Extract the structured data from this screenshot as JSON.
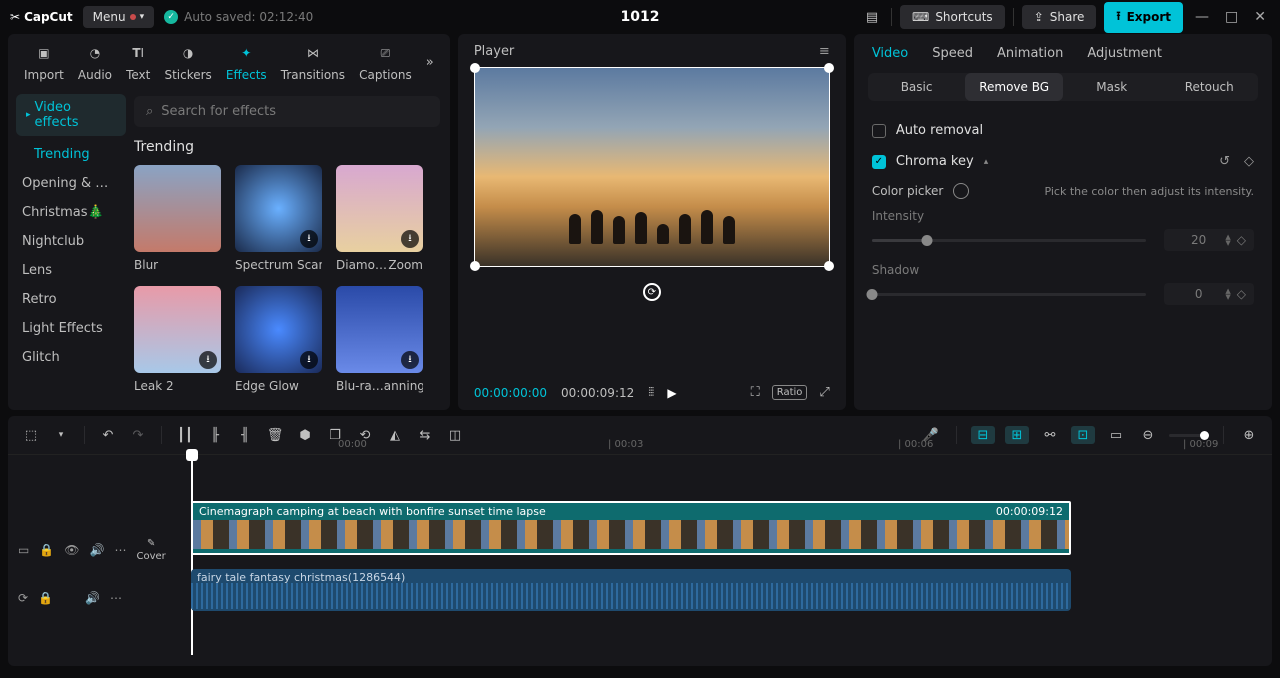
{
  "brand": "CapCut",
  "menu": "Menu",
  "autosave_label": "Auto saved: 02:12:40",
  "project_title": "1012",
  "top_buttons": {
    "shortcuts": "Shortcuts",
    "share": "Share",
    "export": "Export"
  },
  "left_tabs": {
    "import": "Import",
    "audio": "Audio",
    "text": "Text",
    "stickers": "Stickers",
    "effects": "Effects",
    "transitions": "Transitions",
    "captions": "Captions"
  },
  "sidebar": {
    "pill": "Video effects",
    "items": [
      "Trending",
      "Opening & …",
      "Christmas🎄",
      "Nightclub",
      "Lens",
      "Retro",
      "Light Effects",
      "Glitch"
    ]
  },
  "search_placeholder": "Search for effects",
  "effects_heading": "Trending",
  "effects": [
    {
      "name": "Blur",
      "sub": ""
    },
    {
      "name": "Spectrum Scan",
      "sub": ""
    },
    {
      "name": "Diamo…",
      "sub": "Zoom"
    },
    {
      "name": "Leak 2",
      "sub": ""
    },
    {
      "name": "Edge Glow",
      "sub": ""
    },
    {
      "name": "Blu-ra…",
      "sub": "anning"
    }
  ],
  "player": {
    "title": "Player",
    "time_current": "00:00:00:00",
    "time_total": "00:00:09:12",
    "ratio": "Ratio"
  },
  "right_tabs": {
    "video": "Video",
    "speed": "Speed",
    "animation": "Animation",
    "adjustment": "Adjustment"
  },
  "segments": {
    "basic": "Basic",
    "removebg": "Remove BG",
    "mask": "Mask",
    "retouch": "Retouch"
  },
  "auto_removal": "Auto removal",
  "chroma_key": "Chroma key",
  "color_picker": "Color picker",
  "picker_hint": "Pick the color then adjust its intensity.",
  "intensity": {
    "label": "Intensity",
    "value": "20"
  },
  "shadow": {
    "label": "Shadow",
    "value": "0"
  },
  "ruler": {
    "m0": "00:00",
    "m3": "| 00:03",
    "m6": "| 00:06",
    "m9": "| 00:09"
  },
  "clip_video": {
    "name": "Cinemagraph camping at beach with bonfire sunset time lapse",
    "dur": "00:00:09:12"
  },
  "clip_audio": {
    "name": "fairy tale fantasy christmas(1286544)"
  },
  "cover": "Cover"
}
